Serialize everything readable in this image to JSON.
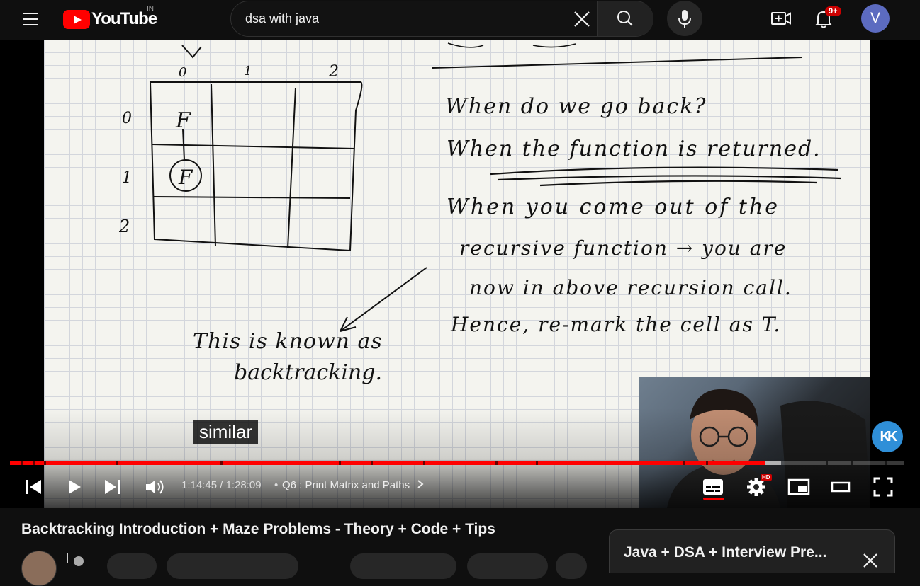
{
  "masthead": {
    "logo_text": "YouTube",
    "country_code": "IN",
    "search": {
      "value": "dsa with java",
      "placeholder": "Search"
    },
    "notifications_count": "9+",
    "avatar_letter": "V"
  },
  "player": {
    "whiteboard": {
      "grid_col_labels": [
        "0",
        "1",
        "2"
      ],
      "grid_row_labels": [
        "0",
        "1",
        "2"
      ],
      "grid_marks": [
        "F",
        "F"
      ],
      "notes": [
        "When do we go back?",
        "When the function is returned.",
        "When you come out of the",
        "recursive function → you are",
        "now in above recursion call.",
        "Hence, re-mark the cell as T.",
        "This is known as",
        "backtracking."
      ]
    },
    "caption": "similar",
    "overlay_badge": "KK",
    "progress_played": 0.8445,
    "progress_buffered": 0.862,
    "time_current": "1:14:45",
    "time_separator": "/",
    "time_total": "1:28:09",
    "chapter_separator": "•",
    "chapter": "Q6 : Print Matrix and Paths",
    "quality_badge": "HD"
  },
  "video": {
    "title": "Backtracking Introduction + Maze Problems - Theory + Code + Tips"
  },
  "playlist": {
    "title": "Java + DSA + Interview Pre..."
  },
  "icons": {
    "menu": "menu-icon",
    "search": "search-icon",
    "clear": "close-icon",
    "mic": "microphone-icon",
    "create": "video-camera-plus-icon",
    "notifications": "bell-icon",
    "prev": "skip-previous-icon",
    "play": "play-icon",
    "next": "skip-next-icon",
    "volume": "volume-icon",
    "chapter_arrow": "chevron-right-icon",
    "subtitles": "subtitles-icon",
    "settings": "gear-icon",
    "miniplayer": "miniplayer-icon",
    "theater": "theater-mode-icon",
    "fullscreen": "fullscreen-icon"
  },
  "colors": {
    "brand_red": "#ff0000",
    "background": "#0f0f0f",
    "avatar": "#5c6bc0",
    "overlay_badge": "#2f8fd8"
  }
}
